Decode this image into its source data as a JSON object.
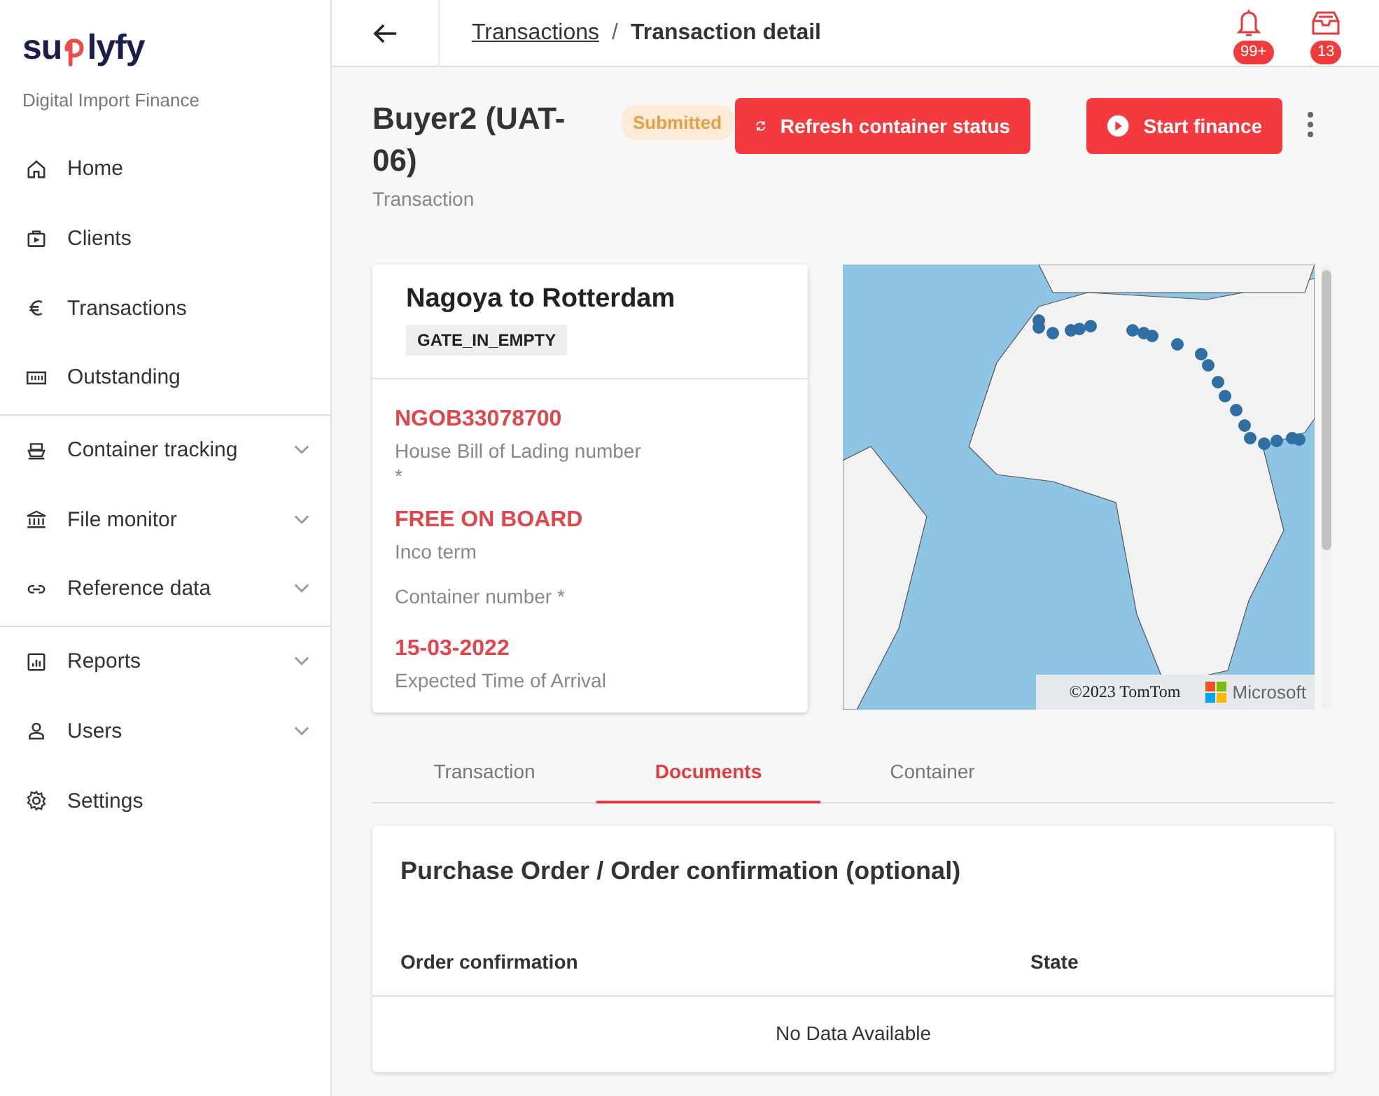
{
  "sidebar": {
    "logo": {
      "before": "su",
      "after": "lyfy"
    },
    "tagline": "Digital Import Finance",
    "groups": [
      {
        "items": [
          {
            "label": "Home",
            "kind": "plain"
          },
          {
            "label": "Clients",
            "kind": "plain"
          },
          {
            "label": "Transactions",
            "kind": "plain"
          },
          {
            "label": "Outstanding",
            "kind": "plain"
          }
        ]
      },
      {
        "items": [
          {
            "label": "Container tracking",
            "kind": "expandable"
          },
          {
            "label": "File monitor",
            "kind": "expandable"
          },
          {
            "label": "Reference data",
            "kind": "expandable"
          }
        ]
      },
      {
        "items": [
          {
            "label": "Reports",
            "kind": "expandable"
          },
          {
            "label": "Users",
            "kind": "expandable"
          },
          {
            "label": "Settings",
            "kind": "plain"
          }
        ]
      }
    ]
  },
  "header": {
    "breadcrumb": {
      "parent": "Transactions",
      "separator": "/",
      "current": "Transaction detail"
    },
    "notifications": {
      "badge": "99+"
    },
    "inbox": {
      "badge": "13"
    }
  },
  "transaction": {
    "title": "Buyer2 (UAT-06)",
    "subtitle": "Transaction",
    "status": "Submitted",
    "buttons": [
      {
        "label": "Refresh container status"
      },
      {
        "label": "Start finance"
      }
    ]
  },
  "shipment": {
    "route": "Nagoya to Rotterdam",
    "event": "GATE_IN_EMPTY",
    "fields": [
      {
        "value": "NGOB33078700",
        "label": "House Bill of Lading number *"
      },
      {
        "value": "FREE ON BOARD",
        "label": "Inco term"
      },
      {
        "label": "Container number *"
      },
      {
        "value": "15-03-2022",
        "label": "Expected Time of Arrival"
      }
    ]
  },
  "map": {
    "attribution": "©2023 TomTom",
    "provider": "Microsoft"
  },
  "tabs": [
    {
      "label": "Transaction",
      "selected": false
    },
    {
      "label": "Documents",
      "selected": true
    },
    {
      "label": "Container",
      "selected": false
    }
  ],
  "documents": {
    "title": "Purchase Order / Order confirmation (optional)",
    "columns": [
      "Order confirmation",
      "State"
    ],
    "empty": "No Data Available"
  }
}
